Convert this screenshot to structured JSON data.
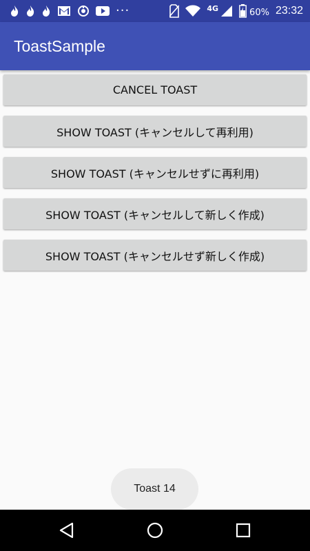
{
  "status_bar": {
    "icons": [
      "flame-icon",
      "flame-icon",
      "flame-icon",
      "gmail-icon",
      "sync-icon",
      "youtube-icon"
    ],
    "overflow": "···",
    "network_type": "4G",
    "battery_percent": "60%",
    "time": "23:32"
  },
  "app_bar": {
    "title": "ToastSample"
  },
  "buttons": [
    {
      "label": "CANCEL TOAST"
    },
    {
      "label": "SHOW TOAST (キャンセルして再利用)"
    },
    {
      "label": "SHOW TOAST (キャンセルせずに再利用)"
    },
    {
      "label": "SHOW TOAST (キャンセルして新しく作成)"
    },
    {
      "label": "SHOW TOAST (キャンセルせず新しく作成)"
    }
  ],
  "toast": {
    "text": "Toast 14"
  },
  "nav_bar": {
    "icons": [
      "back-icon",
      "home-icon",
      "recent-apps-icon"
    ]
  },
  "colors": {
    "status_bar": "#303f9f",
    "app_bar": "#3f51b5",
    "button": "#d6d7d7",
    "toast": "#ebebeb"
  }
}
